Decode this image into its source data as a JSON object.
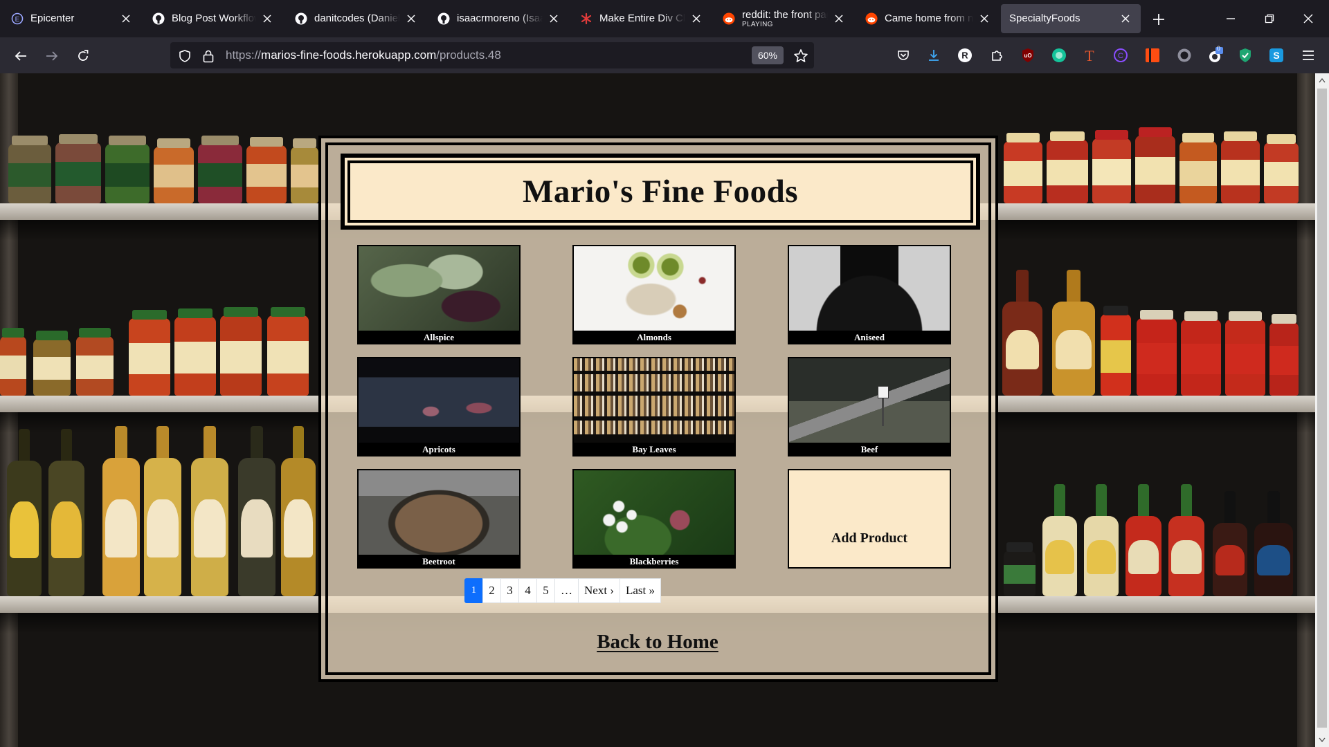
{
  "browser": {
    "tabs": [
      {
        "title": "Epicenter",
        "icon": "epicenter-icon"
      },
      {
        "title": "Blog Post Workflow",
        "icon": "github-icon"
      },
      {
        "title": "danitcodes (Danielle",
        "icon": "github-icon"
      },
      {
        "title": "isaacrmoreno (Isaac",
        "icon": "github-icon"
      },
      {
        "title": "Make Entire Div Click",
        "icon": "asterisk-icon"
      },
      {
        "title": "reddit: the front page",
        "subtitle": "PLAYING",
        "icon": "reddit-icon"
      },
      {
        "title": "Came home from nic",
        "icon": "reddit-icon"
      },
      {
        "title": "SpecialtyFoods",
        "icon": ""
      }
    ],
    "url": {
      "scheme": "https://",
      "host": "marios-fine-foods.herokuapp.com",
      "path": "/products.48"
    },
    "zoom": "60%",
    "extension_badge": "0",
    "accent": "#0d6efd"
  },
  "site": {
    "title": "Mario's Fine Foods",
    "products": [
      {
        "name": "Allspice"
      },
      {
        "name": "Almonds"
      },
      {
        "name": "Aniseed"
      },
      {
        "name": "Apricots"
      },
      {
        "name": "Bay Leaves"
      },
      {
        "name": "Beef"
      },
      {
        "name": "Beetroot"
      },
      {
        "name": "Blackberries"
      }
    ],
    "add_product": "Add Product",
    "pagination": {
      "pages": [
        "1",
        "2",
        "3",
        "4",
        "5"
      ],
      "current": "1",
      "ellipsis": "…",
      "next": "Next ›",
      "last": "Last »"
    },
    "back_home": "Back to Home"
  }
}
